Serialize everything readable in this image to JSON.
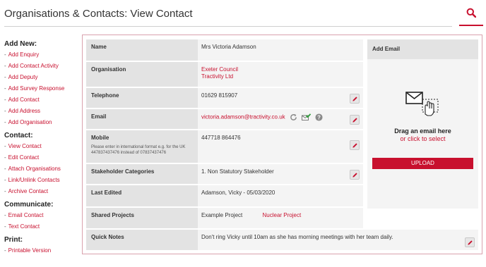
{
  "header": {
    "title": "Organisations & Contacts: View Contact"
  },
  "sidebar": {
    "groups": [
      {
        "heading": "Add New:",
        "items": [
          "Add Enquiry",
          "Add Contact Activity",
          "Add Deputy",
          "Add Survey Response",
          "Add Contact",
          "Add Address",
          "Add Organisation"
        ]
      },
      {
        "heading": "Contact:",
        "items": [
          "View Contact",
          "Edit Contact",
          "Attach Organisations",
          "Link/Unlink Contacts",
          "Archive Contact"
        ]
      },
      {
        "heading": "Communicate:",
        "items": [
          "Email Contact",
          "Text Contact"
        ]
      },
      {
        "heading": "Print:",
        "items": [
          "Printable Version"
        ]
      }
    ]
  },
  "contact": {
    "name_label": "Name",
    "name": "Mrs Victoria Adamson",
    "organisation_label": "Organisation",
    "organisations": [
      "Exeter Council",
      "Tractivity Ltd"
    ],
    "telephone_label": "Telephone",
    "telephone": "01629 815907",
    "email_label": "Email",
    "email": "victoria.adamson@tractivity.co.uk",
    "mobile_label": "Mobile",
    "mobile_note": "Please enter in international format e.g. for the UK 447837437476 instead of 07837437476",
    "mobile": "447718 864476",
    "stakeholder_label": "Stakeholder Categories",
    "stakeholder": "1. Non Statutory Stakeholder",
    "last_edited_label": "Last Edited",
    "last_edited": "Adamson, Vicky - 05/03/2020",
    "shared_projects_label": "Shared Projects",
    "shared_projects": [
      "Example Project",
      "Nuclear Project"
    ],
    "quick_notes_label": "Quick Notes",
    "quick_notes": "Don't ring Vicky until 10am as she has morning meetings with her team daily."
  },
  "email_panel": {
    "title": "Add Email",
    "drag_text": "Drag an email here",
    "click_text": "or click to select",
    "upload_label": "UPLOAD"
  },
  "icons": {
    "search": "search-icon",
    "edit": "pencil-icon",
    "refresh": "refresh-icon",
    "verified": "mail-check-icon",
    "help": "help-icon",
    "drop": "envelope-hand-icon"
  },
  "colors": {
    "accent": "#c8102e",
    "label_bg": "#e3e3e3",
    "value_bg": "#f4f4f4",
    "panel_border": "#d9a1ad"
  }
}
